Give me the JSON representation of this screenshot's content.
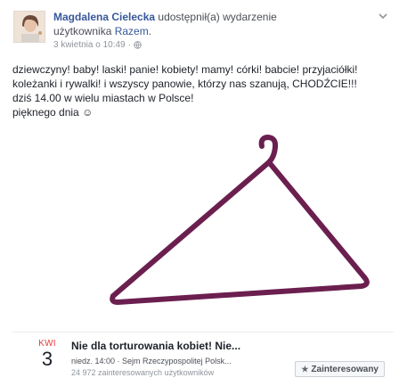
{
  "post": {
    "author": "Magdalena Cielecka",
    "action_text": " udostępnił(a) wydarzenie",
    "page_prefix": "użytkownika ",
    "page_name": "Razem",
    "page_suffix": ".",
    "timestamp": "3 kwietnia o 10:49",
    "separator": "·",
    "body_lines": [
      "dziewczyny! baby! laski! panie! kobiety! mamy! córki! babcie! przyjaciółki!",
      "koleżanki i rywalki! i wszyscy panowie, którzy nas szanują, CHODŹCIE!!!",
      "dziś 14.00 w wielu miastach w Polsce!",
      "pięknego dnia ☺"
    ],
    "image": {
      "hanger_color": "#6b1f4f"
    }
  },
  "event": {
    "month": "KWI",
    "day": "3",
    "title": "Nie dla torturowania kobiet! Nie...",
    "detail": "niedz. 14:00 · Sejm Rzeczypospolitej Polsk...",
    "count": "24 972 zainteresowanych użytkowników",
    "interest_label": "Zainteresowany",
    "interest_icon": "star-icon"
  },
  "colors": {
    "link": "#365899",
    "month": "#e33b3b"
  }
}
